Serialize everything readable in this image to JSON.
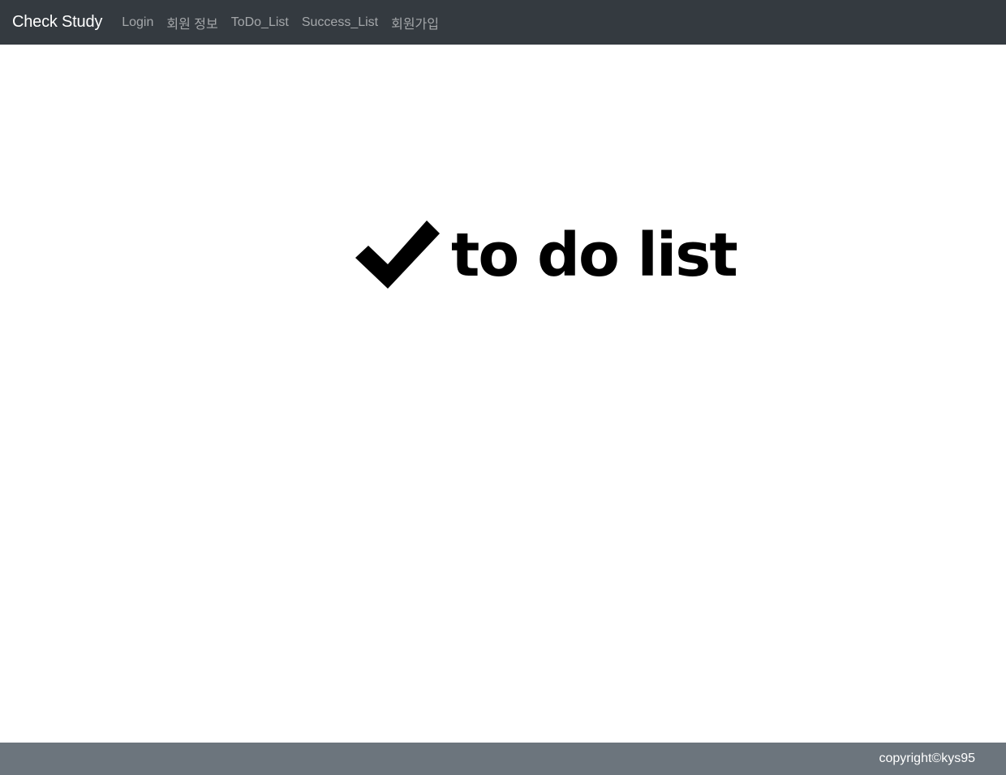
{
  "navbar": {
    "brand": "Check Study",
    "links": [
      {
        "label": "Login"
      },
      {
        "label": "회원 정보"
      },
      {
        "label": "ToDo_List"
      },
      {
        "label": "Success_List"
      },
      {
        "label": "회원가입"
      }
    ]
  },
  "main": {
    "logo": {
      "icon": "checkmark-icon",
      "text": "to do list"
    }
  },
  "footer": {
    "copyright": "copyright©kys95"
  },
  "colors": {
    "navbar_bg": "#343a40",
    "footer_bg": "#6c757d",
    "nav_link": "rgba(255,255,255,0.55)",
    "logo": "#000000"
  }
}
